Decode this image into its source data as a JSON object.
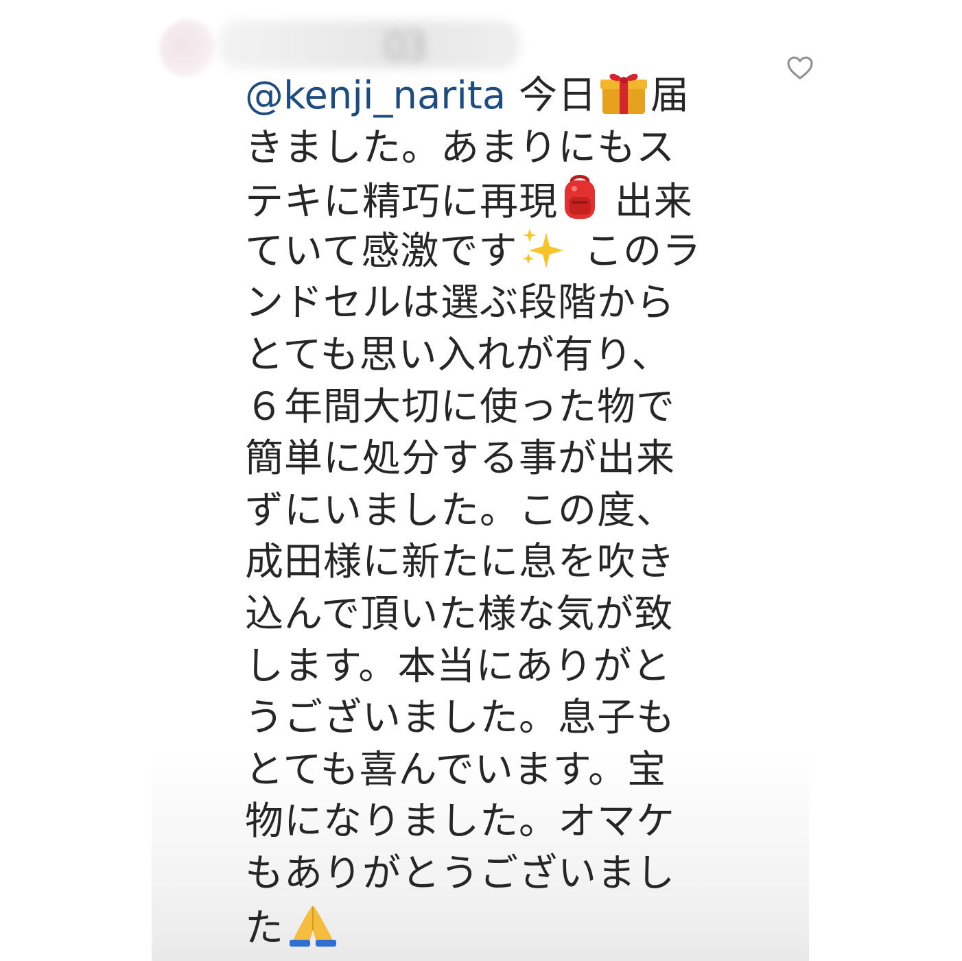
{
  "comment": {
    "username_obscured": "03",
    "mention": "@kenji_narita",
    "emoji": {
      "gift": "gift-emoji",
      "backpack": "backpack-emoji",
      "sparkles": "sparkles-emoji",
      "pray": "pray-emoji"
    },
    "lines": [
      {
        "before": " 今日",
        "after": "届"
      },
      {
        "text": "きました。あまりにもス"
      },
      {
        "before": "テキに精巧に再現",
        "after": " 出来"
      },
      {
        "before": "ていて感激です",
        "after": " このラ"
      },
      {
        "text": "ンドセルは選ぶ段階から"
      },
      {
        "text": "とても思い入れが有り、"
      },
      {
        "text": "６年間大切に使った物で"
      },
      {
        "text": "簡単に処分する事が出来"
      },
      {
        "text": "ずにいました。この度、"
      },
      {
        "text": "成田様に新たに息を吹き"
      },
      {
        "text": "込んで頂いた様な気が致"
      },
      {
        "text": "します。本当にありがと"
      },
      {
        "text": "うございました。息子も"
      },
      {
        "text": "とても喜んでいます。宝"
      },
      {
        "text": "物になりました。オマケ"
      },
      {
        "text": "もありがとうございまし"
      },
      {
        "before": "た",
        "after": ""
      }
    ]
  },
  "colors": {
    "mention": "#1e4c7e",
    "text": "#262626",
    "heart_outline": "#8e8e8e"
  }
}
